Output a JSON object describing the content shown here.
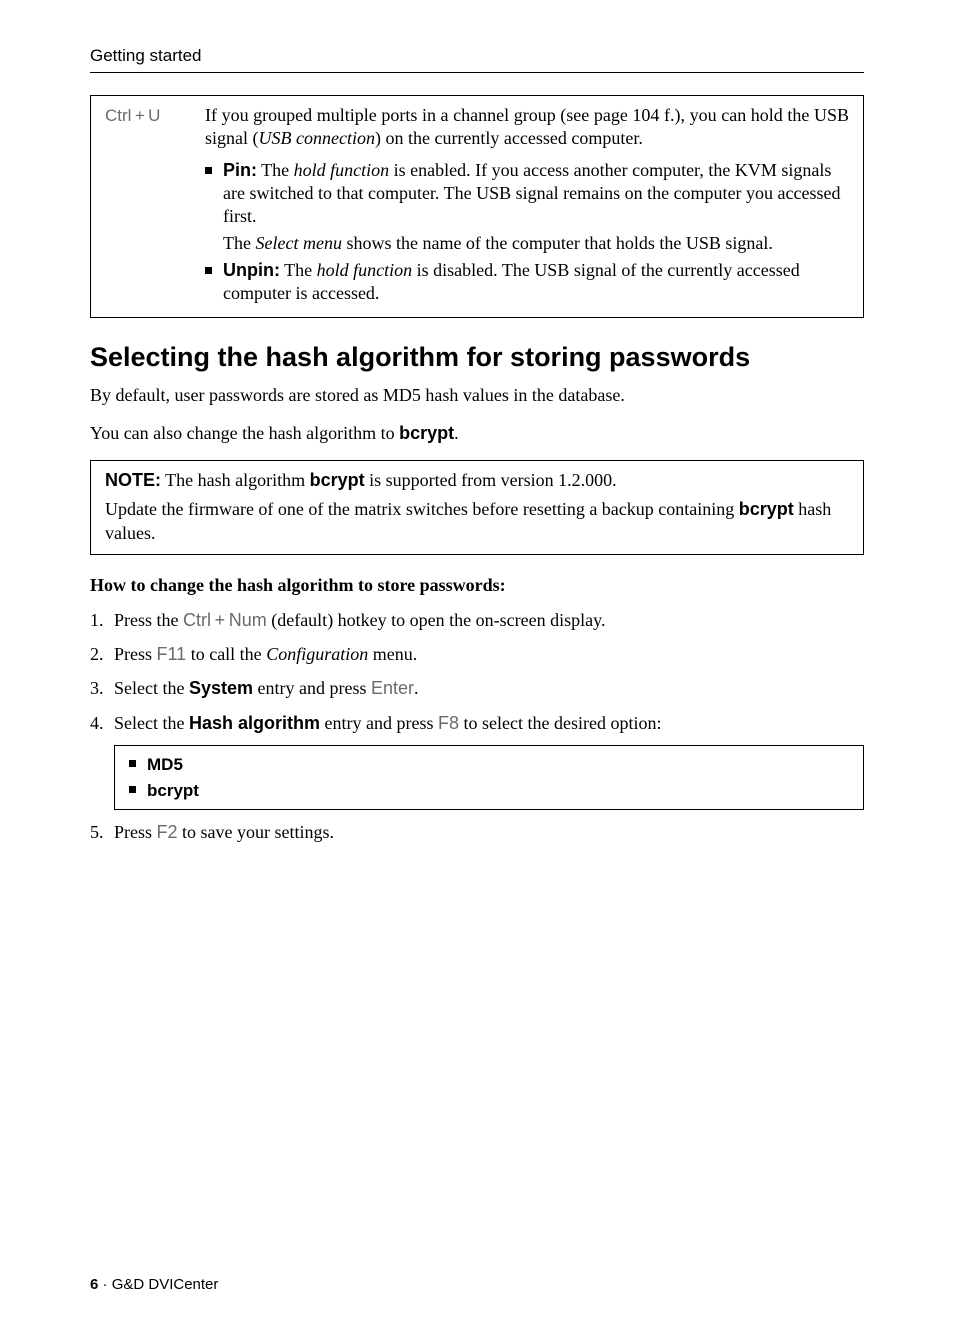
{
  "running_head": "Getting started",
  "hotkey_box": {
    "hotkey": "Ctrl + U",
    "intro_a": "If you grouped multiple ports in a channel group (see page 104 f.), you can hold the USB signal (",
    "intro_i": "USB connection",
    "intro_b": ") on the currently accessed computer.",
    "pin": {
      "label": "Pin:",
      "text_a": " The ",
      "text_i": "hold function",
      "text_b": " is enabled. If you access another computer, the KVM signals are switched to that computer. The USB signal remains on the computer you accessed first.",
      "sub_a": "The ",
      "sub_i": "Select menu",
      "sub_b": " shows the name of the computer that holds the USB signal."
    },
    "unpin": {
      "label": "Unpin:",
      "text_a": " The ",
      "text_i": "hold function",
      "text_b": " is disabled. The USB signal of the currently accessed computer is accessed."
    }
  },
  "section_title": "Selecting the hash algorithm for storing passwords",
  "para1": "By default, user passwords are stored as MD5 hash values in the database.",
  "para2_a": "You can also change the hash algorithm to ",
  "para2_b": "bcrypt",
  "para2_c": ".",
  "note": {
    "label": "NOTE:",
    "l1_a": " The hash algorithm ",
    "l1_b": "bcrypt",
    "l1_c": " is supported from version 1.2.000.",
    "l2_a": "Update the firmware of one of the matrix switches before resetting a backup containing ",
    "l2_b": "bcrypt",
    "l2_c": " hash values."
  },
  "proc_head": "How to change the hash algorithm to store passwords:",
  "steps": {
    "s1_a": "Press the ",
    "s1_k": "Ctrl + Num",
    "s1_b": " (default) hotkey to open the on-screen display.",
    "s2_a": "Press ",
    "s2_k": "F11",
    "s2_b": " to call the ",
    "s2_i": "Configuration",
    "s2_c": " menu.",
    "s3_a": "Select the ",
    "s3_b": "System",
    "s3_c": " entry and press ",
    "s3_k": "Enter",
    "s3_d": ".",
    "s4_a": "Select the ",
    "s4_b": "Hash algorithm",
    "s4_c": " entry and press ",
    "s4_k": "F8",
    "s4_d": " to select the desired option:",
    "opt1": "MD5",
    "opt2": "bcrypt",
    "s5_a": "Press ",
    "s5_k": "F2",
    "s5_b": " to save your settings."
  },
  "footer": {
    "page": "6",
    "sep": " · ",
    "title": "G&D DVICenter"
  }
}
